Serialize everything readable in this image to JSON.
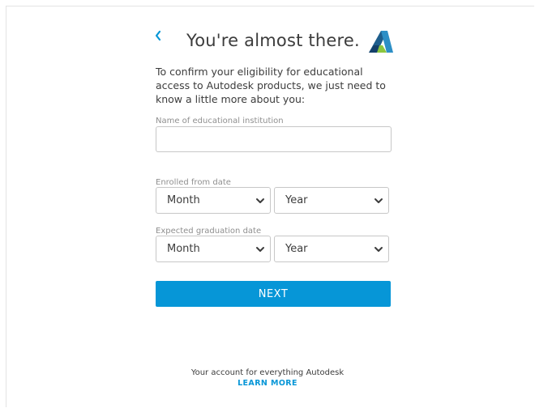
{
  "header": {
    "title": "You're almost there.",
    "back_icon": "chevron-left-icon",
    "logo": "autodesk-logo"
  },
  "intro_text": "To confirm your eligibility for educational access to Autodesk products, we just need to know a little more about you:",
  "institution": {
    "label": "Name of educational institution",
    "value": ""
  },
  "enrolled": {
    "label": "Enrolled from date",
    "month": "Month",
    "year": "Year"
  },
  "graduation": {
    "label": "Expected graduation date",
    "month": "Month",
    "year": "Year"
  },
  "next_button": "NEXT",
  "footer": {
    "text": "Your account for everything Autodesk",
    "link": "LEARN MORE"
  },
  "colors": {
    "accent": "#0696d7",
    "text": "#3c3c3c",
    "label": "#8f8f8f",
    "border": "#c7c7c7"
  }
}
